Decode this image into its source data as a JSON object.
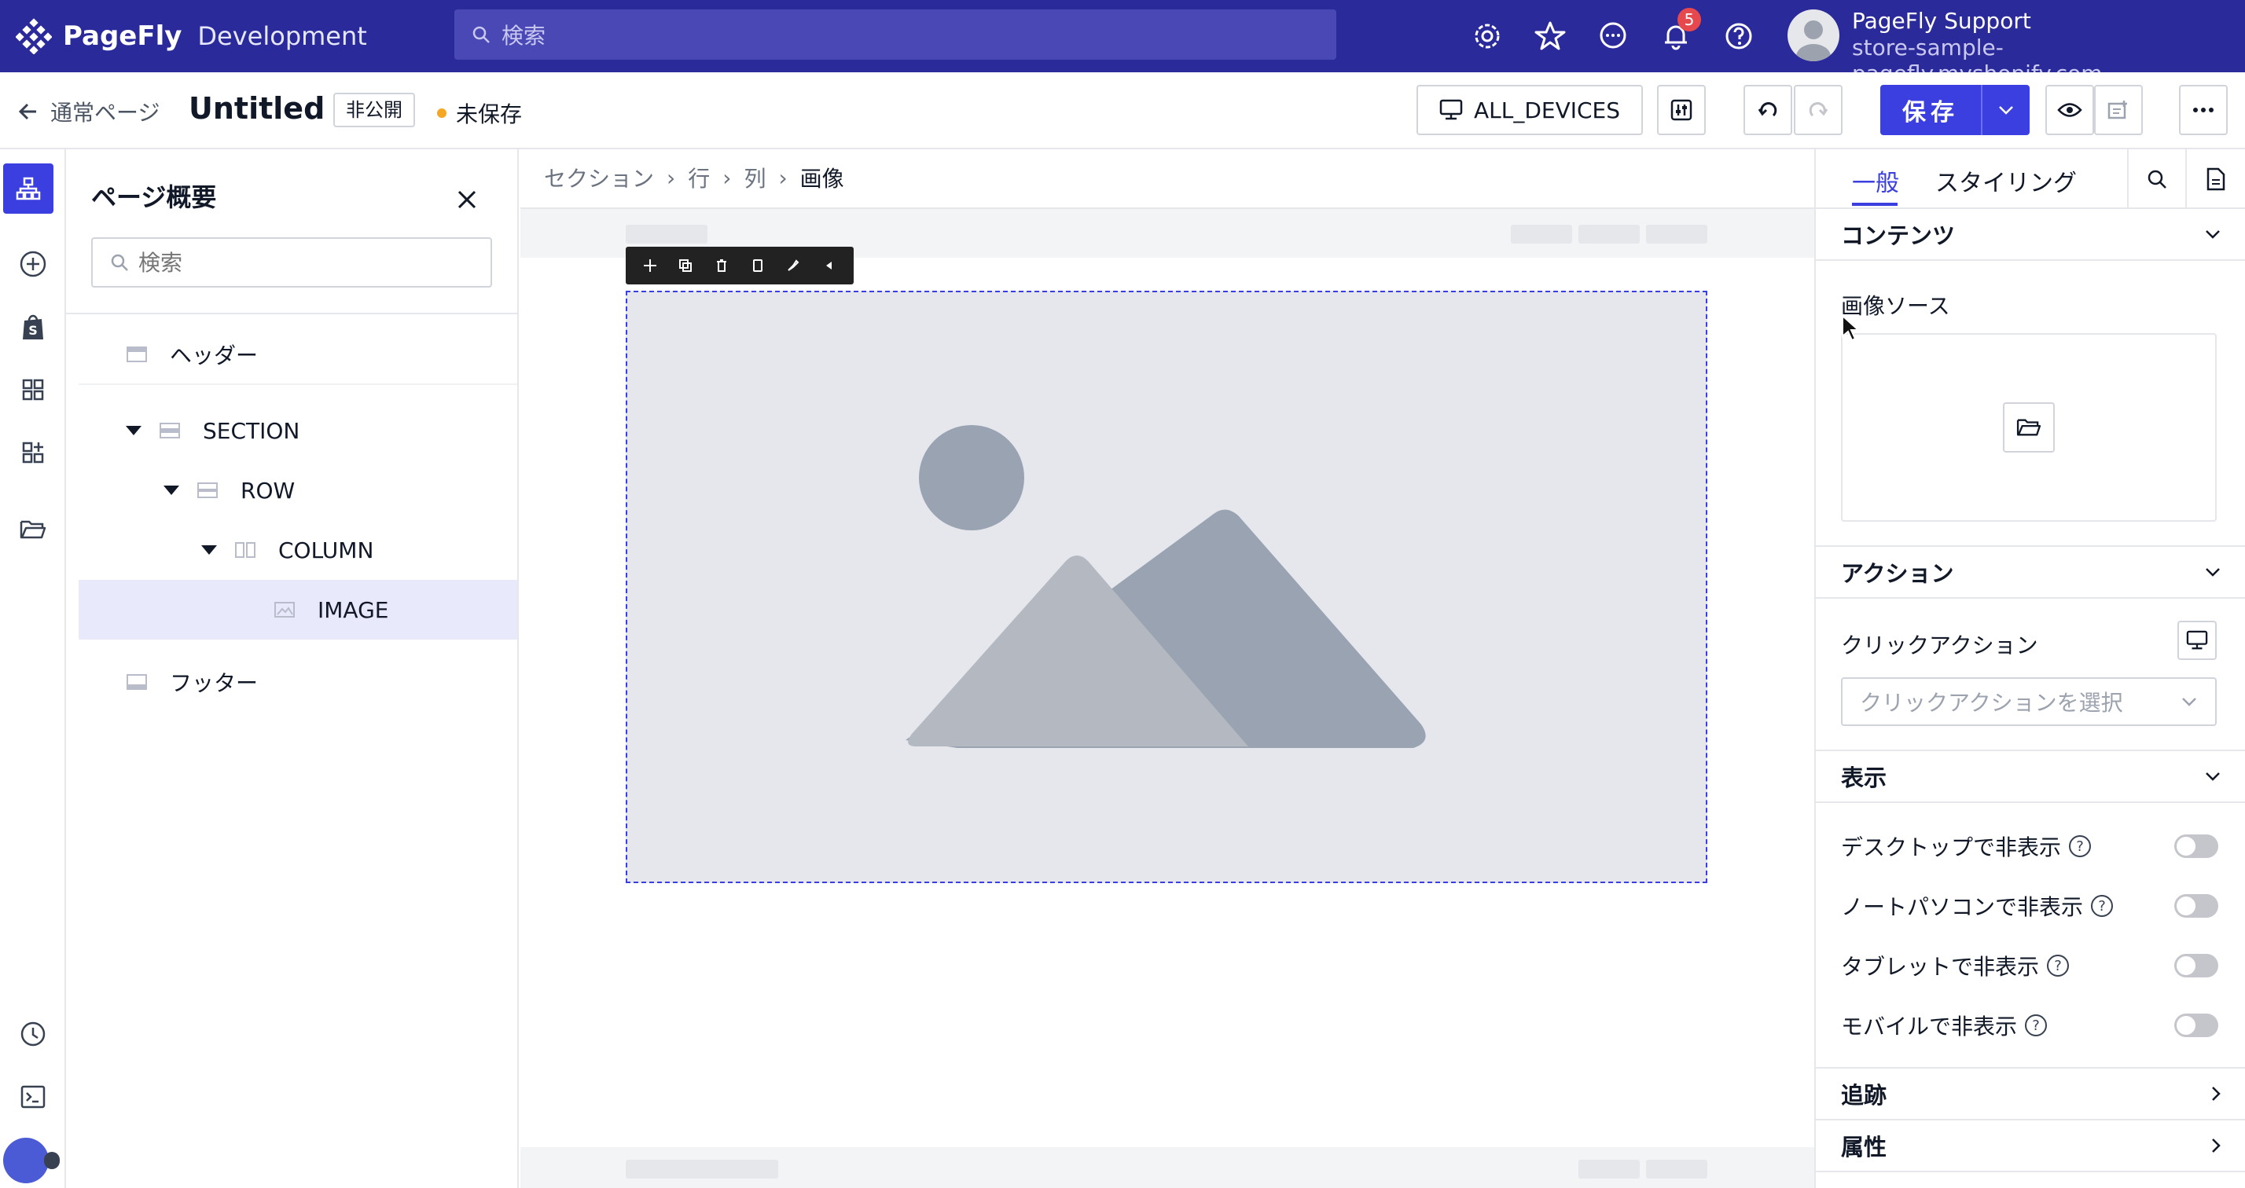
{
  "app": {
    "brand_name": "PageFly",
    "brand_sub": "Development",
    "search_placeholder": "検索",
    "notification_count": "5",
    "user_name": "PageFly Support",
    "user_store": "store-sample-pagefly.myshopify.com"
  },
  "page_bar": {
    "back_label": "通常ページ",
    "title": "Untitled",
    "status_badge": "非公開",
    "unsaved_label": "未保存",
    "device_label": "ALL_DEVICES",
    "save_label": "保存"
  },
  "outline": {
    "title": "ページ概要",
    "search_placeholder": "検索",
    "items": [
      {
        "label": "ヘッダー"
      },
      {
        "label": "SECTION"
      },
      {
        "label": "ROW"
      },
      {
        "label": "COLUMN"
      },
      {
        "label": "IMAGE"
      },
      {
        "label": "フッター"
      }
    ]
  },
  "canvas": {
    "breadcrumb": [
      "セクション",
      "行",
      "列",
      "画像"
    ]
  },
  "inspector": {
    "tabs": [
      "一般",
      "スタイリング"
    ],
    "sections": {
      "content": "コンテンツ",
      "action": "アクション",
      "display": "表示",
      "tracking": "追跡",
      "attributes": "属性"
    },
    "image_source_label": "画像ソース",
    "click_action_label": "クリックアクション",
    "click_action_placeholder": "クリックアクションを選択",
    "visibility": [
      {
        "label": "デスクトップで非表示",
        "on": false
      },
      {
        "label": "ノートパソコンで非表示",
        "on": false
      },
      {
        "label": "タブレットで非表示",
        "on": false
      },
      {
        "label": "モバイルで非表示",
        "on": false
      }
    ]
  },
  "colors": {
    "topbar": "#2b2a9a",
    "accent": "#3b3fe0",
    "unsaved_dot": "#f5a623",
    "badge": "#e5484d"
  }
}
